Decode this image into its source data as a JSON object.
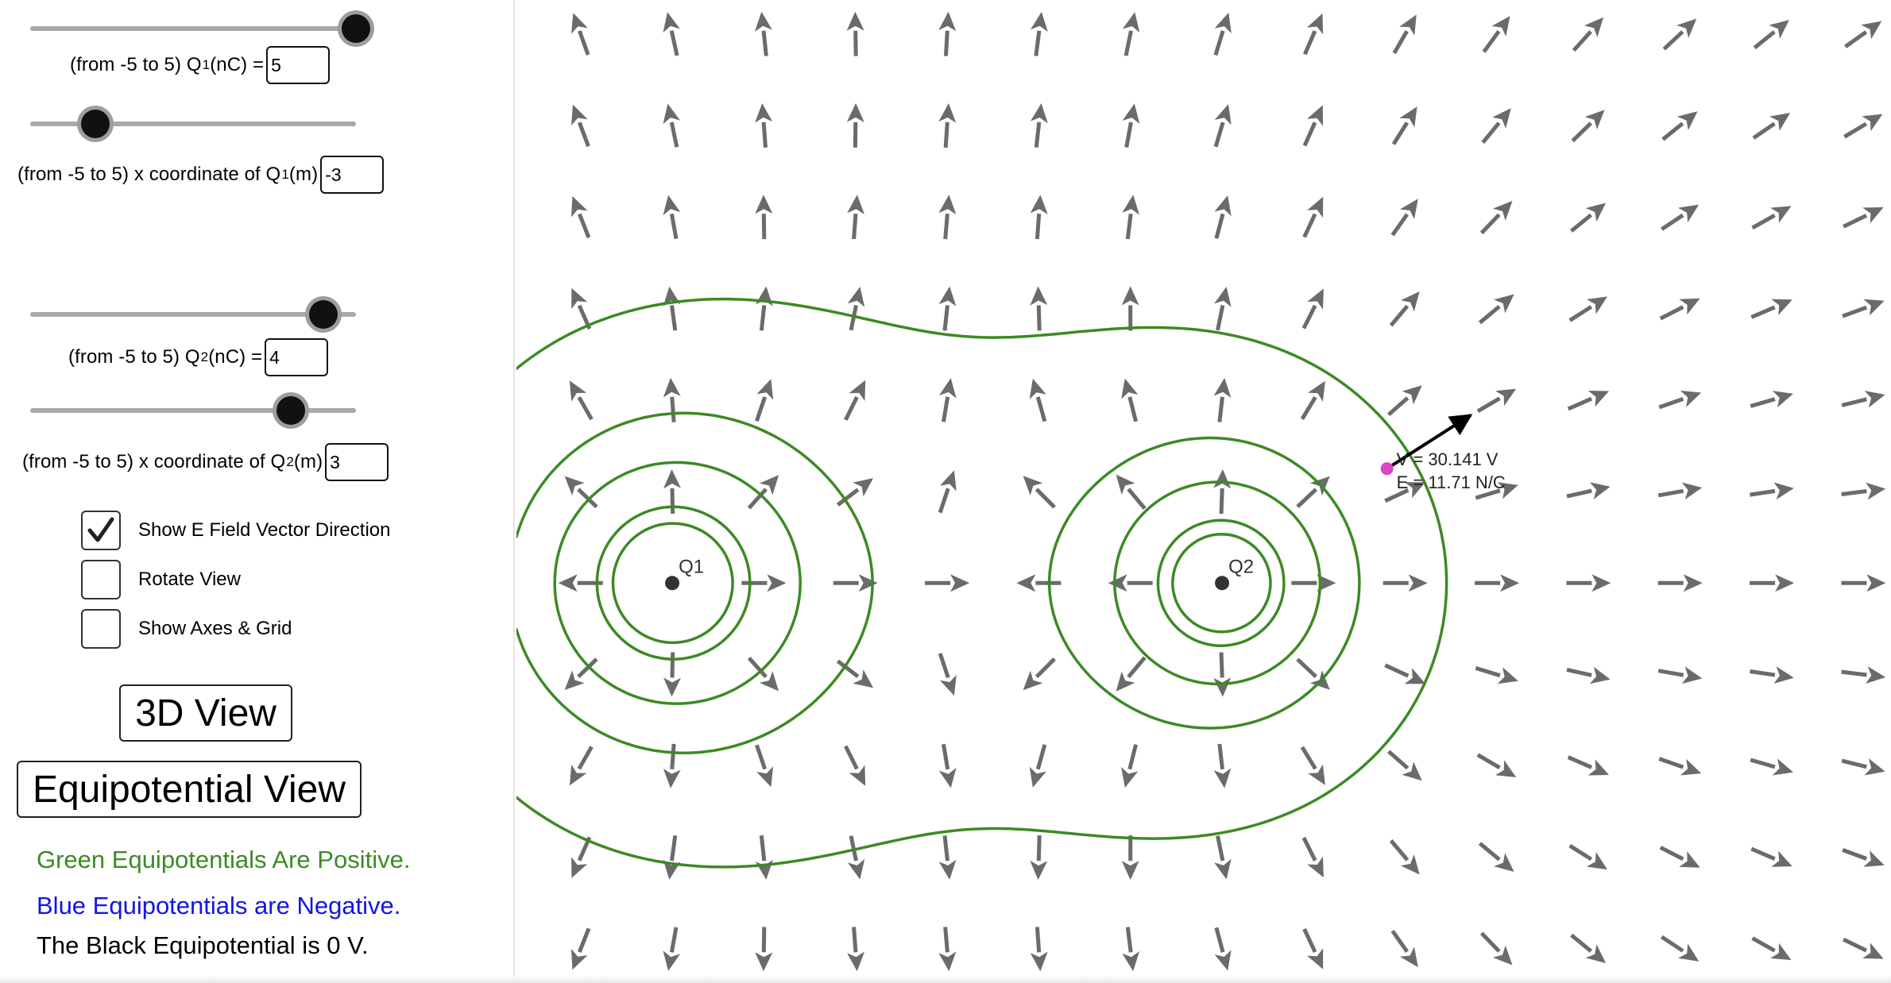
{
  "controls": {
    "q1_charge": {
      "label": "(from -5 to 5) Q",
      "sub": "1",
      "suffix": " (nC) =",
      "value": "5",
      "slider_value": 5
    },
    "q1_x": {
      "label": "(from -5 to 5) x coordinate of Q",
      "sub": "1",
      "suffix": " (m)",
      "value": "-3",
      "slider_value": -3
    },
    "q2_charge": {
      "label": "(from -5 to 5) Q",
      "sub": "2",
      "suffix": " (nC) =",
      "value": "4",
      "slider_value": 4
    },
    "q2_x": {
      "label": "(from -5 to 5) x coordinate of Q",
      "sub": "2",
      "suffix": " (m)",
      "value": "3",
      "slider_value": 3
    },
    "slider_min": -5,
    "slider_max": 5
  },
  "checkboxes": [
    {
      "label": "Show E Field Vector Direction",
      "checked": true
    },
    {
      "label": "Rotate View",
      "checked": false
    },
    {
      "label": "Show Axes & Grid",
      "checked": false
    }
  ],
  "buttons": {
    "view3d": "3D View",
    "equipotential": "Equipotential View"
  },
  "notes": {
    "positive": "Green Equipotentials Are Positive.",
    "negative": "Blue Equipotentials are Negative.",
    "zero": "The Black Equipotential is 0 V."
  },
  "plot": {
    "charges": [
      {
        "label": "Q1",
        "q": 5,
        "x": -3,
        "y": 0
      },
      {
        "label": "Q2",
        "q": 4,
        "x": 3,
        "y": 0
      }
    ],
    "probe": {
      "x": 4.8,
      "y": 1.25,
      "v_text": "V = 30.141 V",
      "e_text": "E = 11.71 N/C"
    },
    "x_range": [
      -4.7,
      10.3
    ],
    "y_range": [
      -4.37,
      6.37
    ],
    "equipotentials_volts": [
      20,
      30,
      40,
      60,
      75
    ],
    "colors": {
      "positive": "#3c8a25",
      "negative": "#1414e6",
      "zero": "#000000",
      "arrow": "#6b6b6b",
      "probe": "#d946c8"
    }
  }
}
